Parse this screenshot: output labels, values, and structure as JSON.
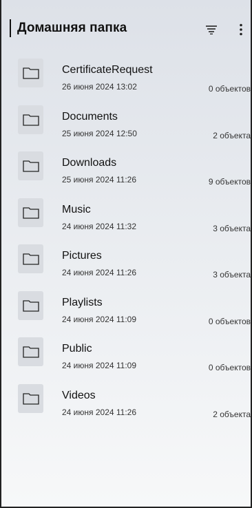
{
  "header": {
    "title": "Домашняя папка"
  },
  "folders": [
    {
      "name": "CertificateRequest",
      "date": "26 июня 2024 13:02",
      "count": "0 объектов"
    },
    {
      "name": "Documents",
      "date": "25 июня 2024 12:50",
      "count": "2 объекта"
    },
    {
      "name": "Downloads",
      "date": "25 июня 2024 11:26",
      "count": "9 объектов"
    },
    {
      "name": "Music",
      "date": "24 июня 2024 11:32",
      "count": "3 объекта"
    },
    {
      "name": "Pictures",
      "date": "24 июня 2024 11:26",
      "count": "3 объекта"
    },
    {
      "name": "Playlists",
      "date": "24 июня 2024 11:09",
      "count": "0 объектов"
    },
    {
      "name": "Public",
      "date": "24 июня 2024 11:09",
      "count": "0 объектов"
    },
    {
      "name": "Videos",
      "date": "24 июня 2024 11:26",
      "count": "2 объекта"
    }
  ],
  "icons": {
    "filter": "filter-icon",
    "more": "more-vertical-icon",
    "folder": "folder-icon"
  }
}
